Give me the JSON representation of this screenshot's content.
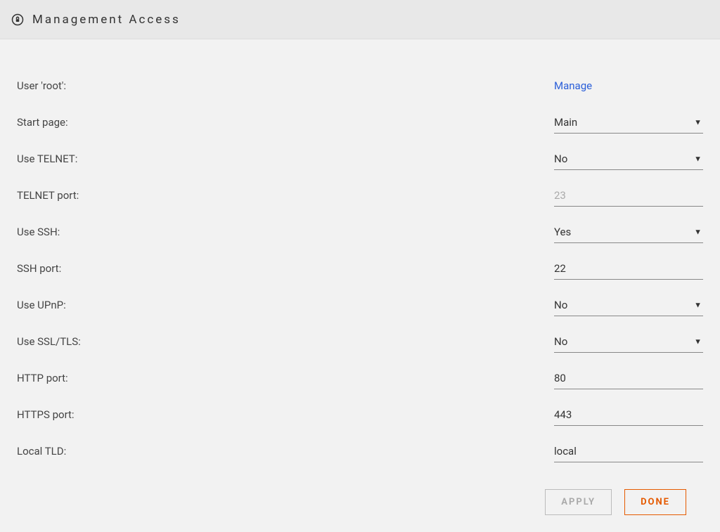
{
  "header": {
    "title": "Management Access"
  },
  "fields": {
    "user_root": {
      "label": "User 'root':",
      "link_text": "Manage"
    },
    "start_page": {
      "label": "Start page:",
      "value": "Main"
    },
    "use_telnet": {
      "label": "Use TELNET:",
      "value": "No"
    },
    "telnet_port": {
      "label": "TELNET port:",
      "value": "23"
    },
    "use_ssh": {
      "label": "Use SSH:",
      "value": "Yes"
    },
    "ssh_port": {
      "label": "SSH port:",
      "value": "22"
    },
    "use_upnp": {
      "label": "Use UPnP:",
      "value": "No"
    },
    "use_ssl": {
      "label": "Use SSL/TLS:",
      "value": "No"
    },
    "http_port": {
      "label": "HTTP port:",
      "value": "80"
    },
    "https_port": {
      "label": "HTTPS port:",
      "value": "443"
    },
    "local_tld": {
      "label": "Local TLD:",
      "value": "local"
    }
  },
  "buttons": {
    "apply": "Apply",
    "done": "Done"
  }
}
